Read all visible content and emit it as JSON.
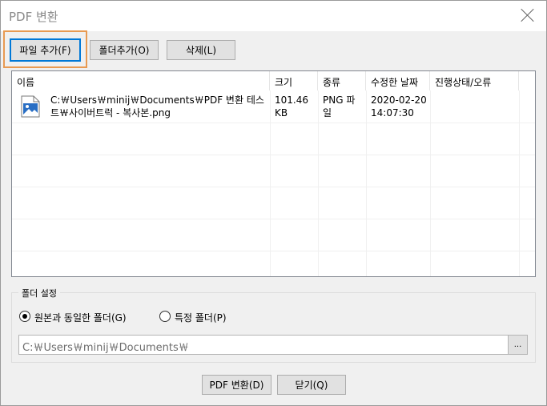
{
  "window": {
    "title": "PDF 변환"
  },
  "toolbar": {
    "add_file": "파일 추가(F)",
    "add_folder": "폴더추가(O)",
    "delete": "삭제(L)"
  },
  "file_list": {
    "columns": [
      "이름",
      "크기",
      "종류",
      "수정한 날짜",
      "진행상태/오류"
    ],
    "rows": [
      {
        "name_line1": "C:￦Users￦minij￦Documents￦PDF 변환 테스",
        "name_line2": "트￦사이버트럭 - 복사본.png",
        "size_line1": "101.46",
        "size_line2": "KB",
        "type_line1": "PNG 파",
        "type_line2": "일",
        "date_line1": "2020-02-20",
        "date_line2": "14:07:30",
        "status": "",
        "icon": "image-file-icon"
      }
    ]
  },
  "folder_settings": {
    "label": "폴더 설정",
    "option_same": "원본과 동일한 폴더(G)",
    "option_specific": "특정 폴더(P)",
    "selected": "same",
    "path": "C:￦Users￦minij￦Documents￦",
    "browse_label": "..."
  },
  "footer": {
    "convert": "PDF 변환(D)",
    "close": "닫기(Q)"
  },
  "colors": {
    "accent": "#0078d7",
    "focus_ring": "#e89a52"
  }
}
